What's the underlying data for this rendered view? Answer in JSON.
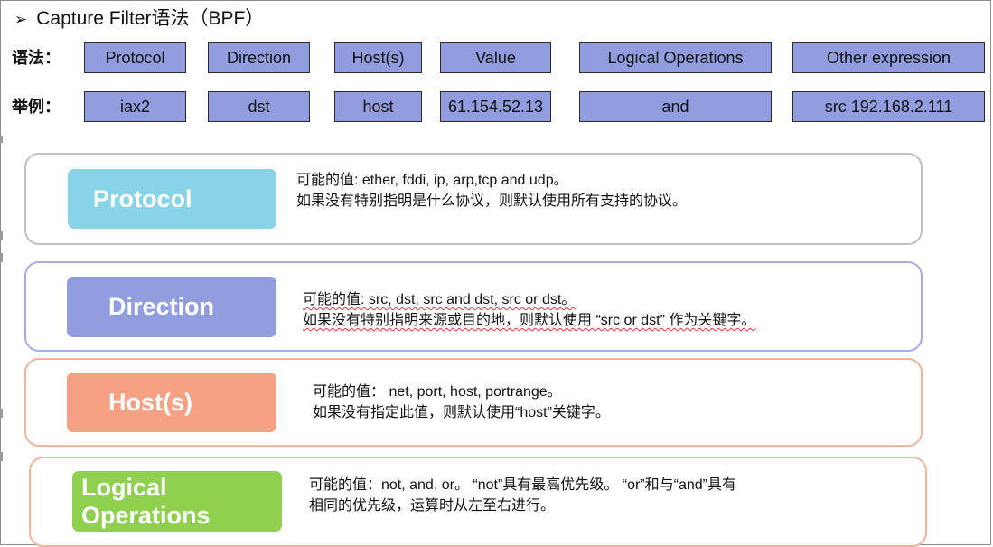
{
  "title": {
    "arrow": "➢",
    "text": "Capture Filter语法（BPF）"
  },
  "syntax_label": "语法：",
  "example_label": "举例：",
  "syntax_cells": [
    "Protocol",
    "Direction",
    "Host(s)",
    "Value",
    "Logical Operations",
    "Other expression"
  ],
  "example_cells": [
    "iax2",
    "dst",
    "host",
    "61.154.52.13",
    "and",
    "src 192.168.2.111"
  ],
  "cards": [
    {
      "tag": "Protocol",
      "tag_color": "#89d3e6",
      "border_color": "#bfc3c8",
      "line1": "可能的值: ether, fddi, ip, arp,tcp and udp。",
      "line2": "如果没有特别指明是什么协议，则默认使用所有支持的协议。"
    },
    {
      "tag": "Direction",
      "tag_color": "#919ddf",
      "border_color": "#a5aee4",
      "line1": "可能的值: src, dst, src and dst, src or dst。",
      "line2": "如果没有特别指明来源或目的地，则默认使用 “src or dst” 作为关键字。"
    },
    {
      "tag": "Host(s)",
      "tag_color": "#f6a184",
      "border_color": "#f3b49c",
      "line1": "可能的值： net, port, host, portrange。",
      "line2": "如果没有指定此值，则默认使用“host”关键字。"
    },
    {
      "tag": "Logical Operations",
      "tag_line1": "Logical",
      "tag_line2": "Operations",
      "tag_color": "#8fd04f",
      "border_color": "#f3b49c",
      "line1": "可能的值：not, and, or。 “not”具有最高优先级。 “or”和与“and”具有",
      "line2": "相同的优先级，运算时从左至右进行。"
    }
  ],
  "colors": {
    "cell_fill": "#919ddf",
    "spellcheck": "#e23b3b"
  }
}
